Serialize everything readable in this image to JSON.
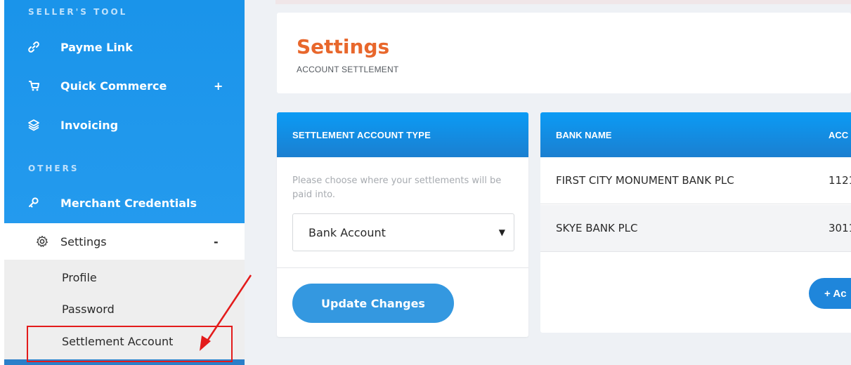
{
  "sidebar": {
    "sections": {
      "sellers_tool": "SELLER'S TOOL",
      "others": "OTHERS"
    },
    "items": [
      {
        "label": "Payme Link",
        "icon": "link-icon"
      },
      {
        "label": "Quick Commerce",
        "icon": "cart-icon",
        "suffix": "+"
      },
      {
        "label": "Invoicing",
        "icon": "layers-icon"
      },
      {
        "label": "Merchant Credentials",
        "icon": "key-icon"
      }
    ],
    "settings": {
      "label": "Settings",
      "icon": "gear-icon",
      "suffix": "-"
    },
    "submenu": [
      "Profile",
      "Password",
      "Settlement Account"
    ]
  },
  "header": {
    "title": "Settings",
    "subtitle": "ACCOUNT SETTLEMENT"
  },
  "settlement_type": {
    "heading": "SETTLEMENT ACCOUNT TYPE",
    "hint": "Please choose where your settlements will be paid into.",
    "selected": "Bank Account",
    "update_label": "Update Changes"
  },
  "accounts_table": {
    "columns": [
      "BANK NAME",
      "ACC"
    ],
    "rows": [
      {
        "bank": "FIRST CITY MONUMENT BANK PLC",
        "account": "1121"
      },
      {
        "bank": "SKYE BANK PLC",
        "account": "3011"
      }
    ],
    "add_label": "+ Ac"
  },
  "colors": {
    "sidebar_blue": "#1a94ea",
    "accent_orange": "#e8672c",
    "button_blue": "#3498e0",
    "highlight_red": "#e31b1b"
  }
}
